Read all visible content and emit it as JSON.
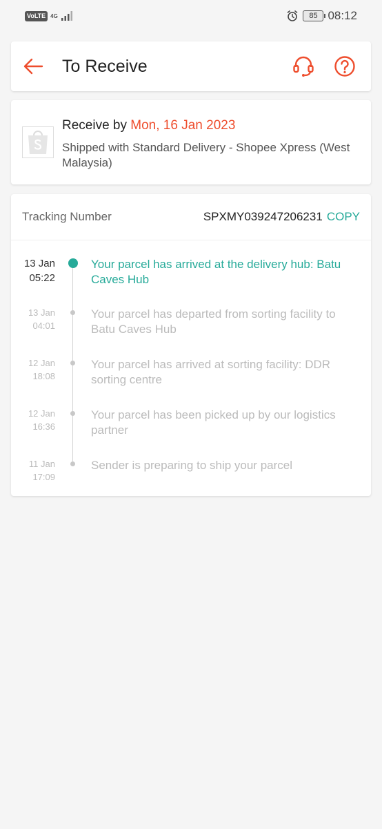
{
  "status_bar": {
    "volte": "VoLTE",
    "network": "4G",
    "battery": "85",
    "time": "08:12"
  },
  "header": {
    "title": "To Receive",
    "back_icon": "arrow-left-icon",
    "support_icon": "headset-icon",
    "help_icon": "question-icon"
  },
  "delivery": {
    "receive_prefix": "Receive by ",
    "receive_date": "Mon, 16 Jan 2023",
    "shipping": "Shipped with Standard Delivery - Shopee Xpress (West Malaysia)"
  },
  "tracking": {
    "label": "Tracking Number",
    "number": "SPXMY039247206231",
    "copy": "COPY",
    "events": [
      {
        "date": "13 Jan",
        "time": "05:22",
        "text": "Your parcel has arrived at the delivery hub: Batu Caves Hub"
      },
      {
        "date": "13 Jan",
        "time": "04:01",
        "text": "Your parcel has departed from sorting facility to Batu Caves Hub"
      },
      {
        "date": "12 Jan",
        "time": "18:08",
        "text": "Your parcel has arrived at sorting facility: DDR sorting centre"
      },
      {
        "date": "12 Jan",
        "time": "16:36",
        "text": "Your parcel has been picked up by our logistics partner"
      },
      {
        "date": "11 Jan",
        "time": "17:09",
        "text": "Sender is preparing to ship your parcel"
      }
    ]
  },
  "colors": {
    "accent": "#ee4d2d",
    "teal": "#26aa99",
    "background": "#f5f5f5"
  }
}
